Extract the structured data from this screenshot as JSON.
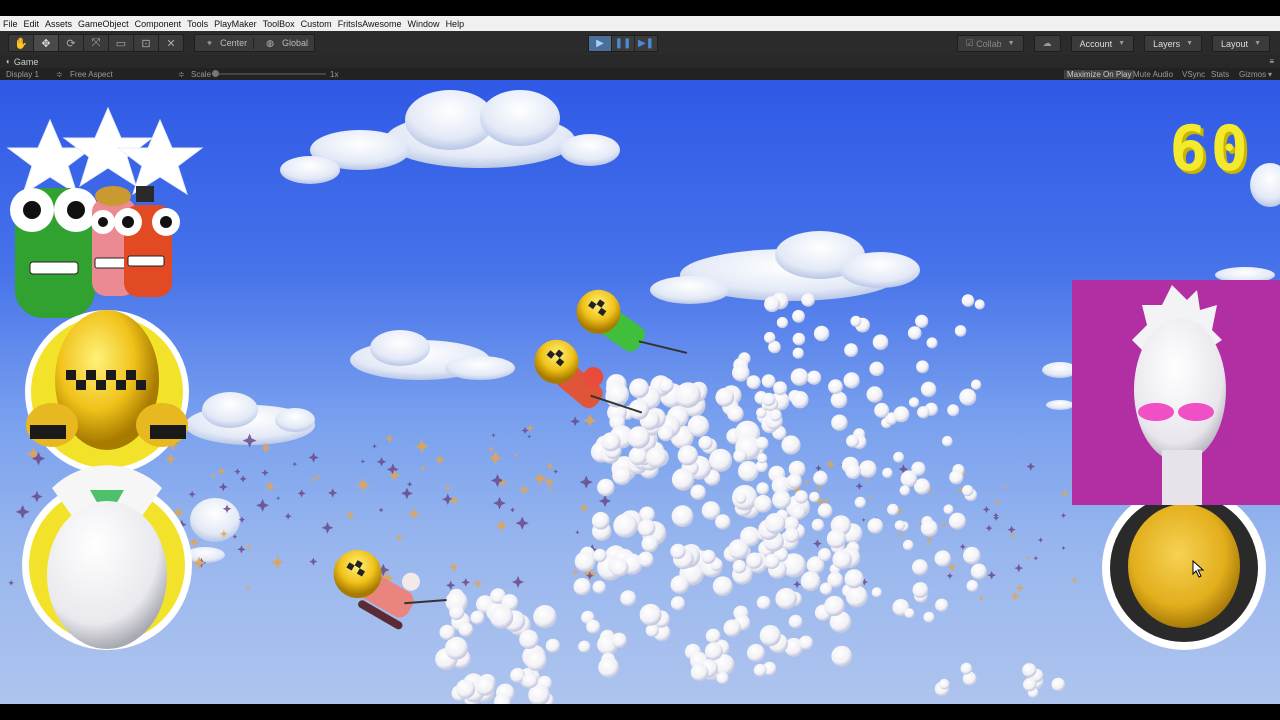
{
  "menu": {
    "items": [
      "File",
      "Edit",
      "Assets",
      "GameObject",
      "Component",
      "Tools",
      "PlayMaker",
      "ToolBox",
      "Custom",
      "FritsIsAwesome",
      "Window",
      "Help"
    ]
  },
  "toolbar": {
    "tools": [
      "hand-tool",
      "move-tool",
      "rotate-tool",
      "scale-tool",
      "rect-tool",
      "transform-tool",
      "custom-tool"
    ],
    "pivot_label": "Center",
    "space_label": "Global",
    "collab_label": "Collab",
    "account_label": "Account",
    "layers_label": "Layers",
    "layout_label": "Layout"
  },
  "game_tab": {
    "title": "Game",
    "display": "Display 1",
    "aspect": "Free Aspect",
    "scale_label": "Scale",
    "scale_value": "1x",
    "maximize": "Maximize On Play",
    "mute": "Mute Audio",
    "vsync": "VSync",
    "stats": "Stats",
    "gizmos": "Gizmos"
  },
  "hud": {
    "timer": "60",
    "stars": 3
  },
  "colors": {
    "accent_play": "#4b6f97",
    "timer_yellow": "#f3ea2e",
    "portrait_bg": "#b12ea3",
    "button_gold": "#e8b820"
  }
}
